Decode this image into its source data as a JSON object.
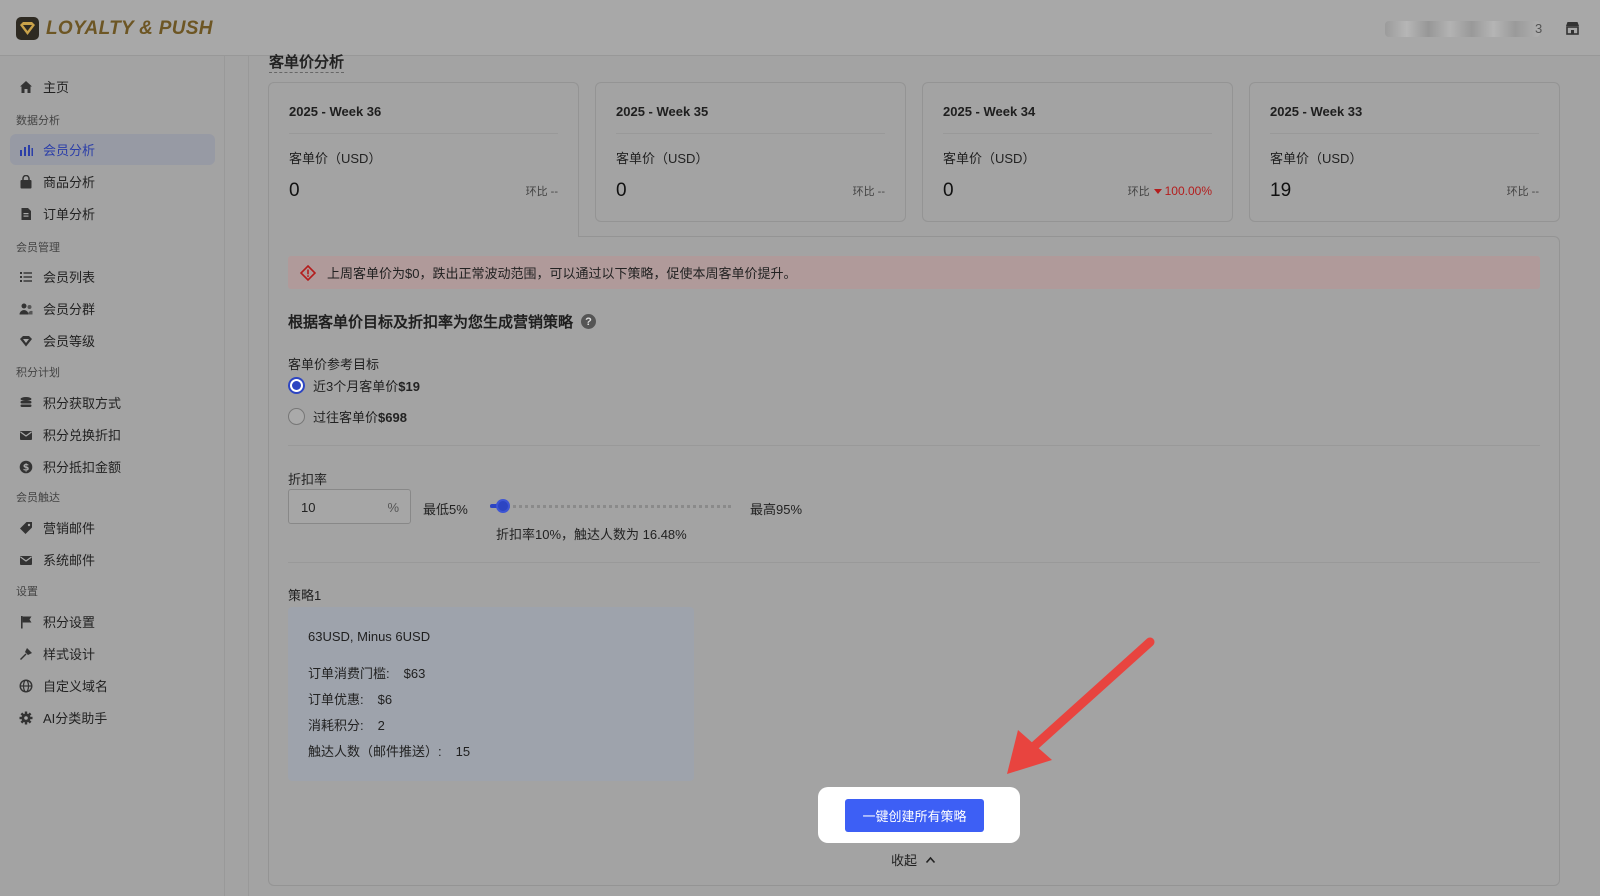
{
  "app": {
    "logo_text": "LOYALTY & PUSH",
    "user_suffix": "3"
  },
  "sidebar": {
    "home": "主页",
    "sections": {
      "analytics": "数据分析",
      "members": "会员管理",
      "points": "积分计划",
      "reach": "会员触达",
      "settings": "设置"
    },
    "items": {
      "member_analysis": "会员分析",
      "product_analysis": "商品分析",
      "order_analysis": "订单分析",
      "member_list": "会员列表",
      "member_segments": "会员分群",
      "member_levels": "会员等级",
      "earn_points": "积分获取方式",
      "redeem_discount": "积分兑换折扣",
      "offset_amount": "积分抵扣金额",
      "marketing_email": "营销邮件",
      "system_email": "系统邮件",
      "points_settings": "积分设置",
      "style_design": "样式设计",
      "custom_domain": "自定义域名",
      "ai_assistant": "AI分类助手"
    }
  },
  "main": {
    "section_title": "客单价分析",
    "weeks": [
      {
        "title": "2025 - Week 36",
        "label": "客单价（USD）",
        "value": "0",
        "ratio_label": "环比",
        "ratio": "--"
      },
      {
        "title": "2025 - Week 35",
        "label": "客单价（USD）",
        "value": "0",
        "ratio_label": "环比",
        "ratio": "--"
      },
      {
        "title": "2025 - Week 34",
        "label": "客单价（USD）",
        "value": "0",
        "ratio_label": "环比",
        "ratio": "100.00%"
      },
      {
        "title": "2025 - Week 33",
        "label": "客单价（USD）",
        "value": "19",
        "ratio_label": "环比",
        "ratio": "--"
      }
    ],
    "alert": "上周客单价为$0，跌出正常波动范围，可以通过以下策略，促使本周客单价提升。",
    "strategy_heading": "根据客单价目标及折扣率为您生成营销策略",
    "target_label": "客单价参考目标",
    "targets": [
      {
        "text": "近3个月客单价",
        "amount": "$19",
        "selected": true
      },
      {
        "text": "过往客单价",
        "amount": "$698",
        "selected": false
      }
    ],
    "discount_label": "折扣率",
    "discount_value": "10",
    "discount_unit": "%",
    "min_label": "最低5%",
    "max_label": "最高95%",
    "slider_percent": 5.6,
    "slider_note": "折扣率10%，触达人数为 16.48%",
    "strategy_label": "策略1",
    "strategy": {
      "name": "63USD, Minus 6USD",
      "threshold_label": "订单消费门槛:",
      "threshold": "$63",
      "discount_label": "订单优惠:",
      "discount": "$6",
      "points_label": "消耗积分:",
      "points": "2",
      "reach_label": "触达人数（邮件推送）:",
      "reach": "15"
    },
    "create_all": "一键创建所有策略",
    "collapse": "收起"
  },
  "colors": {
    "primary": "#3d5ff5",
    "annotation_arrow": "#e8443f",
    "negative": "#b41d1d"
  }
}
